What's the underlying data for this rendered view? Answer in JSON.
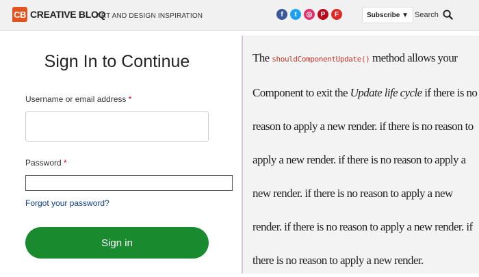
{
  "header": {
    "logo_mark": "CB",
    "logo_name": "CREATIVE BLOQ",
    "tagline": "ART AND DESIGN INSPIRATION",
    "social": [
      {
        "icon": "facebook-icon",
        "glyph": "f",
        "color": "#3b5998"
      },
      {
        "icon": "twitter-icon",
        "glyph": "t",
        "color": "#1da1f2"
      },
      {
        "icon": "instagram-icon",
        "glyph": "◎",
        "color": "#e1306c"
      },
      {
        "icon": "pinterest-icon",
        "glyph": "P",
        "color": "#bd081c"
      },
      {
        "icon": "flipboard-icon",
        "glyph": "F",
        "color": "#e12828"
      }
    ],
    "subscribe_label": "Subscribe ▼",
    "search_label": "Search"
  },
  "form": {
    "title": "Sign In to Continue",
    "username_label": "Username or email address",
    "password_label": "Password",
    "required_mark": "*",
    "forgot_label": "Forgot your password?",
    "signin_label": "Sign in"
  },
  "article": {
    "before_code": "The ",
    "code": "shouldComponentUpdate()",
    "mid": " method allows your Component to exit the ",
    "italic": "Update life cycle",
    "after": " if there is no reason to apply a new render. if there is no reason to apply a new render. if there is no reason to apply a new render. if there is no reason to apply a new render. if there is no reason to apply a new render. if there is no reason to apply a new render."
  },
  "colors": {
    "brand": "#e2531f",
    "button": "#1a8a2e",
    "link": "#0b3e8a"
  }
}
